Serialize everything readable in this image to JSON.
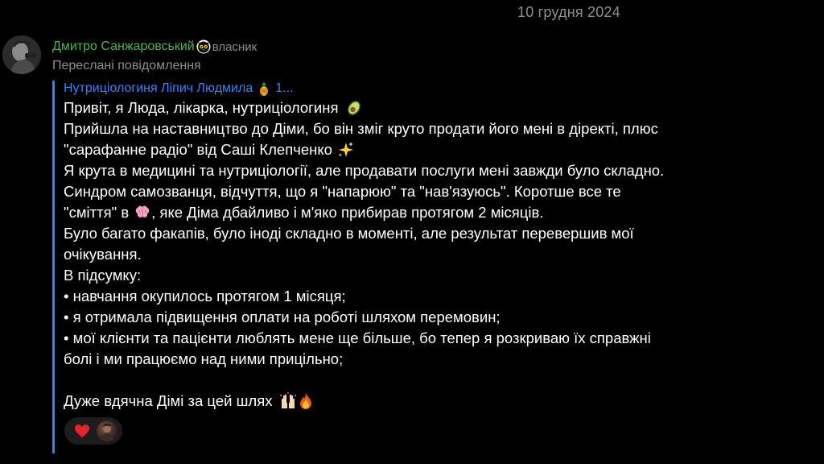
{
  "date_separator": "10 грудня 2024",
  "sender": {
    "name": "Дмитро Санжаровський",
    "role": "власник",
    "avatar_icon": "user-avatar",
    "role_icon": "owl-owner-icon",
    "name_color": "#43b84a"
  },
  "forwarded_label": "Переслані повідомлення",
  "forward_source": {
    "name": "Нутриціологиня Ліпич Людмила",
    "emoji": "pineapple",
    "suffix": "1...",
    "color": "#3b82f6"
  },
  "message": {
    "lines": [
      {
        "text": "Привіт, я Люда, лікарка, нутриціологиня",
        "emoji_after": "avocado"
      },
      {
        "text": "Прийшла на наставництво до Діми, бо він зміг круто продати його мені в діректі, плюс"
      },
      {
        "text": "\"сарафанне радіо\" від Саші Клепченко",
        "emoji_after": "sparkles"
      },
      {
        "text": "Я крута в медицині та нутриціології, але продавати послуги мені завжди було складно."
      },
      {
        "text": "Синдром самозванця, відчуття, що я \"напарюю\" та \"нав'язуюсь\". Коротше все те"
      },
      {
        "text_before": "\"сміття\" в",
        "emoji_mid": "brain",
        "text_after": ", яке Діма дбайливо і м'яко прибирав протягом 2 місяців."
      },
      {
        "text": "Було багато факапів, було іноді складно в моменті, але результат перевершив мої"
      },
      {
        "text": "очікування."
      },
      {
        "text": "В підсумку:"
      },
      {
        "text": "• навчання окупилось протягом 1 місяця;"
      },
      {
        "text": "• я отримала підвищення оплати на роботі шляхом перемовин;"
      },
      {
        "text": "• мої клієнти та пацієнти люблять мене ще більше, бо тепер я розкриваю їх справжні"
      },
      {
        "text": "болі і ми працюємо над ними прицільно;"
      },
      {
        "text": ""
      },
      {
        "text": "Дуже вдячна Дімі за цей шлях",
        "emoji_after": "raised-hands-fire"
      }
    ]
  },
  "reactions": {
    "emoji": "red-heart",
    "reactor_avatar": "reactor-avatar",
    "heart_color": "#e3242b"
  },
  "accent_quote_color": "#3b82f6"
}
